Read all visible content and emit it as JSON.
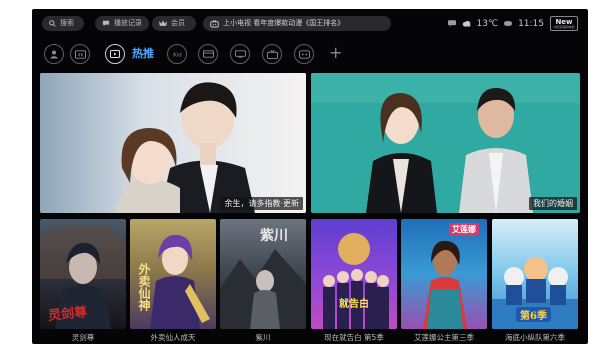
{
  "topbar": {
    "search_label": "搜索",
    "history_label": "播放记录",
    "vip_label": "会员",
    "banner_text": "上小电视 看年度爆款动漫《国王排名》",
    "temperature": "13℃",
    "time": "11:15",
    "logo_text": "New",
    "logo_sub": "中国互联网电视"
  },
  "nav": {
    "active_label": "热推",
    "icons": [
      "kids-icon",
      "sports-icon",
      "recommend-icon",
      "kid-icon",
      "movie-icon",
      "tv-icon",
      "variety-icon",
      "anime-icon"
    ],
    "plus": "+"
  },
  "heroes": [
    {
      "caption": "余生，请多指教·更新"
    },
    {
      "caption": "我们的婚姻"
    }
  ],
  "posters": [
    {
      "title": "灵剑尊",
      "tag": "灵剑尊"
    },
    {
      "title": "外卖仙人成天",
      "tag": "外卖仙神"
    },
    {
      "title": "紫川",
      "tag": "紫川"
    },
    {
      "title": "现在就告白 第5季",
      "tag": "就告白"
    },
    {
      "title": "艾莲娜公主第三季",
      "tag": "艾莲娜"
    },
    {
      "title": "海底小纵队第六季",
      "tag": "第6季"
    }
  ],
  "colors": {
    "accent": "#4fa8ff",
    "background": "#050507"
  }
}
